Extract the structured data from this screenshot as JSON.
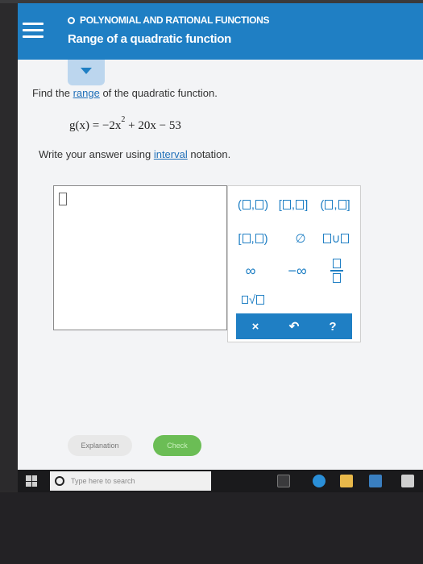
{
  "header": {
    "topic": "POLYNOMIAL AND RATIONAL FUNCTIONS",
    "title": "Range of a quadratic function"
  },
  "problem": {
    "prompt_before": "Find the ",
    "prompt_link": "range",
    "prompt_after": " of the quadratic function.",
    "equation_lhs": "g(x) = −2x",
    "equation_exp": "2",
    "equation_rhs": " + 20x − 53",
    "write_before": "Write your answer using ",
    "write_link": "interval",
    "write_after": " notation."
  },
  "keypad": {
    "empty_set": "∅",
    "union": "∪",
    "infinity": "∞",
    "neg_infinity": "−∞",
    "sqrt": "√",
    "clear": "×",
    "undo": "↶",
    "help": "?"
  },
  "actions": {
    "explanation": "Explanation",
    "check": "Check"
  },
  "taskbar": {
    "search_placeholder": "Type here to search"
  },
  "colors": {
    "brand": "#1f7fc4",
    "check": "#6bbd55"
  }
}
